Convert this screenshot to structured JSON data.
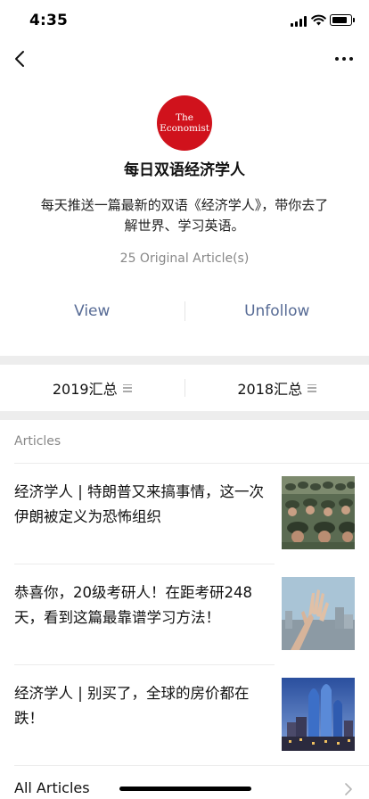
{
  "status_bar": {
    "time": "4:35"
  },
  "nav": {
    "back_icon": "chevron-left-icon",
    "more_icon": "ellipsis-icon"
  },
  "account": {
    "logo_line1": "The",
    "logo_line2": "Economist",
    "logo_color": "#d0121c",
    "name": "每日双语经济学人",
    "description": "每天推送一篇最新的双语《经济学人》，带你去了解世界、学习英语。",
    "article_count": "25 Original Article(s)"
  },
  "actions": {
    "view_label": "View",
    "unfollow_label": "Unfollow",
    "link_color": "#576b95"
  },
  "menu": {
    "items": [
      {
        "label": "2019汇总"
      },
      {
        "label": "2018汇总"
      }
    ]
  },
  "articles": {
    "section_label": "Articles",
    "items": [
      {
        "title": "经济学人 | 特朗普又来搞事情，这一次伊朗被定义为恐怖组织",
        "thumb": "soldiers-photo"
      },
      {
        "title": "恭喜你，20级考研人！在距考研248天，看到这篇最靠谱学习方法！",
        "thumb": "raised-hand-photo"
      },
      {
        "title": "经济学人 | 别买了，全球的房价都在跌！",
        "thumb": "city-skyline-photo"
      }
    ],
    "all_label": "All Articles"
  }
}
